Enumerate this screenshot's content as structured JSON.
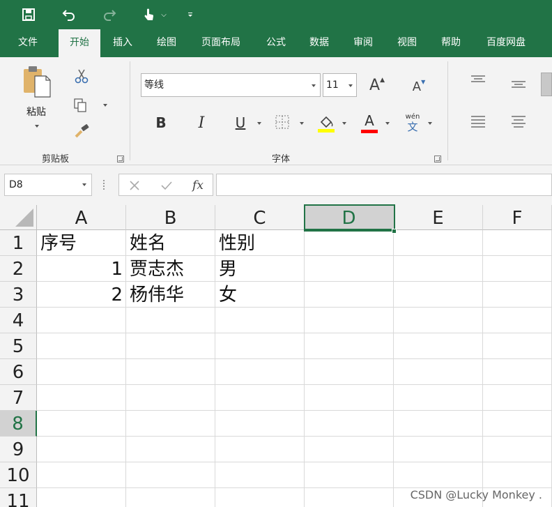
{
  "quick_access": {
    "save_icon": "save-icon",
    "undo_icon": "undo-icon",
    "redo_icon": "redo-icon",
    "touch_icon": "touch-mode-icon",
    "customize_icon": "customize-qat-icon"
  },
  "tabs": [
    {
      "label": "文件"
    },
    {
      "label": "开始"
    },
    {
      "label": "插入"
    },
    {
      "label": "绘图"
    },
    {
      "label": "页面布局"
    },
    {
      "label": "公式"
    },
    {
      "label": "数据"
    },
    {
      "label": "审阅"
    },
    {
      "label": "视图"
    },
    {
      "label": "帮助"
    },
    {
      "label": "百度网盘"
    }
  ],
  "ribbon": {
    "clipboard": {
      "paste_label": "粘贴",
      "group_label": "剪贴板"
    },
    "font": {
      "font_name": "等线",
      "font_size": "11",
      "bold": "B",
      "italic": "I",
      "underline": "U",
      "font_color_letter": "A",
      "phonetic_top": "wén",
      "phonetic_bottom": "文",
      "grow_letter": "A",
      "shrink_letter": "A",
      "group_label": "字体",
      "highlight_color": "#ffff00",
      "font_color": "#ff0000"
    }
  },
  "formula_bar": {
    "name_box": "D8",
    "fx_label": "fx",
    "cancel_icon": "cancel-icon",
    "enter_icon": "check-icon",
    "content": ""
  },
  "sheet": {
    "columns": [
      "A",
      "B",
      "C",
      "D",
      "E",
      "F"
    ],
    "rows": [
      "1",
      "2",
      "3",
      "4",
      "5",
      "6",
      "7",
      "8",
      "9",
      "10",
      "11"
    ],
    "selected_column": "D",
    "selected_row": "8",
    "cells": {
      "A1": "序号",
      "B1": "姓名",
      "C1": "性别",
      "A2": "1",
      "B2": "贾志杰",
      "C2": "男",
      "A3": "2",
      "B3": "杨伟华",
      "C3": "女"
    }
  },
  "colors": {
    "brand": "#217346",
    "ribbon_bg": "#f3f3f3"
  },
  "watermark": "CSDN @Lucky Monkey ."
}
